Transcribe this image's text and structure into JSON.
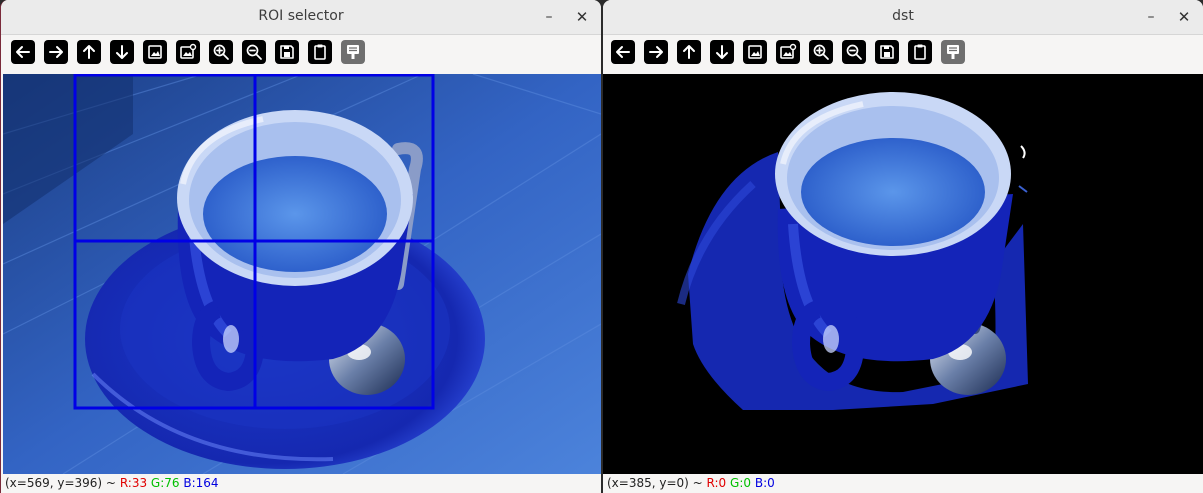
{
  "windows": {
    "left": {
      "title": "ROI selector",
      "minimize_glyph": "–",
      "close_glyph": "✕",
      "status": {
        "coords": "(x=569, y=396) ~",
        "r": "R:33",
        "g": "G:76",
        "b": "B:164"
      }
    },
    "right": {
      "title": "dst",
      "minimize_glyph": "–",
      "close_glyph": "✕",
      "status": {
        "coords": "(x=385, y=0) ~",
        "r": "R:0",
        "g": "G:0",
        "b": "B:0"
      }
    }
  },
  "toolbar_icons": [
    "arrow-left-icon",
    "arrow-right-icon",
    "arrow-up-icon",
    "arrow-down-icon",
    "image-icon",
    "image-settings-icon",
    "zoom-in-icon",
    "zoom-out-icon",
    "save-icon",
    "clipboard-icon",
    "properties-icon"
  ],
  "colors": {
    "roi_rect": "#0000e6",
    "status_red": "#e00000",
    "status_green": "#00c000",
    "status_blue": "#0000e0"
  }
}
